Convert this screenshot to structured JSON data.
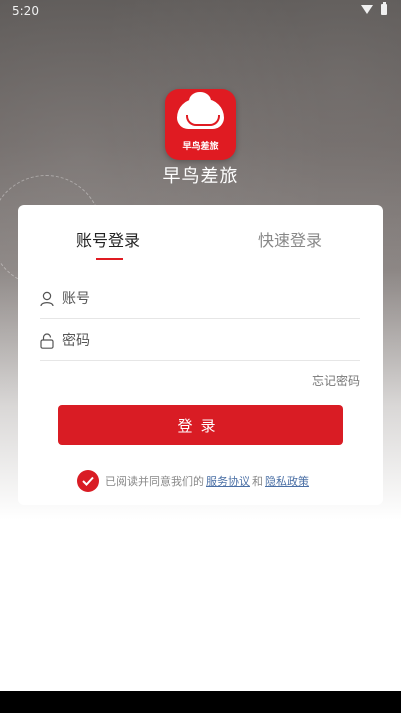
{
  "status_bar": {
    "time": "5:20"
  },
  "app": {
    "logo_text": "早鸟差旅",
    "name": "早鸟差旅"
  },
  "tabs": {
    "account_login": "账号登录",
    "quick_login": "快速登录"
  },
  "form": {
    "account_placeholder": "账号",
    "password_placeholder": "密码",
    "forgot_password": "忘记密码",
    "login_button": "登录"
  },
  "agreement": {
    "prefix": "已阅读并同意我们的",
    "service_link": "服务协议",
    "and": "和",
    "privacy_link": "隐私政策",
    "checked": true
  },
  "colors": {
    "accent": "#d91c24",
    "link": "#4a6fa5"
  }
}
